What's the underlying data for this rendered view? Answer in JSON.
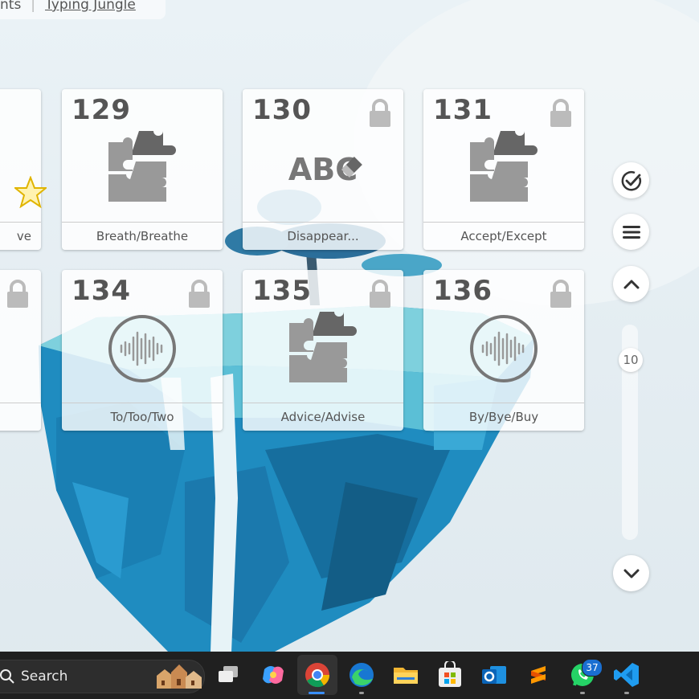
{
  "breadcrumb": {
    "prev": "nts",
    "link": "Typing Jungle"
  },
  "cards": [
    {
      "number": "",
      "label": "ve",
      "locked": false,
      "icon": "star-icon"
    },
    {
      "number": "129",
      "label": "Breath/Breathe",
      "locked": false,
      "icon": "puzzle-icon"
    },
    {
      "number": "130",
      "label": "Disappear...",
      "locked": true,
      "icon": "abc-eraser-icon",
      "icon_text": "ABC"
    },
    {
      "number": "131",
      "label": "Accept/Except",
      "locked": true,
      "icon": "puzzle-icon"
    },
    {
      "number": "",
      "label": "",
      "locked": true,
      "icon": ""
    },
    {
      "number": "134",
      "label": "To/Too/Two",
      "locked": true,
      "icon": "sound-wave-icon"
    },
    {
      "number": "135",
      "label": "Advice/Advise",
      "locked": true,
      "icon": "puzzle-icon"
    },
    {
      "number": "136",
      "label": "By/Bye/Buy",
      "locked": true,
      "icon": "sound-wave-icon"
    }
  ],
  "sidebar": {
    "slider_value": "10"
  },
  "taskbar": {
    "search_label": "Search",
    "whatsapp_badge": "37",
    "apps": [
      "task-view",
      "copilot",
      "chrome",
      "edge",
      "file-explorer",
      "microsoft-store",
      "outlook",
      "sublime",
      "whatsapp",
      "vscode"
    ]
  },
  "colors": {
    "card_text": "#555555",
    "taskbar": "#202020",
    "badge": "#1a6fd1",
    "water": "#2a8fc4"
  }
}
